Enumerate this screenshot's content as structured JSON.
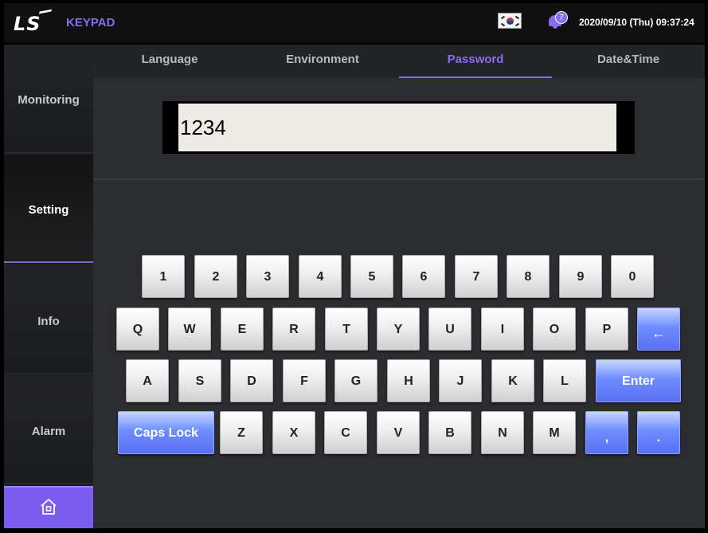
{
  "header": {
    "logo": "LS",
    "title": "KEYPAD",
    "notification_count": "7",
    "datetime": "2020/09/10 (Thu) 09:37:24"
  },
  "sidebar": {
    "items": [
      {
        "label": "Monitoring"
      },
      {
        "label": "Setting",
        "active": true
      },
      {
        "label": "Info"
      },
      {
        "label": "Alarm"
      }
    ],
    "home_icon": "home-icon"
  },
  "tabs": [
    {
      "label": "Language"
    },
    {
      "label": "Environment"
    },
    {
      "label": "Password",
      "active": true
    },
    {
      "label": "Date&Time"
    }
  ],
  "password": {
    "value": "1234"
  },
  "keyboard": {
    "row1": [
      "1",
      "2",
      "3",
      "4",
      "5",
      "6",
      "7",
      "8",
      "9",
      "0"
    ],
    "row2": [
      "Q",
      "W",
      "E",
      "R",
      "T",
      "Y",
      "U",
      "I",
      "O",
      "P"
    ],
    "backspace": "←",
    "row3": [
      "A",
      "S",
      "D",
      "F",
      "G",
      "H",
      "J",
      "K",
      "L"
    ],
    "enter": "Enter",
    "caps_lock": "Caps Lock",
    "row4": [
      "Z",
      "X",
      "C",
      "V",
      "B",
      "N",
      "M"
    ],
    "comma": ",",
    "period": "."
  },
  "colors": {
    "accent": "#8a6cf2",
    "special_key": "#6e8eff",
    "background": "#2c2d31"
  }
}
